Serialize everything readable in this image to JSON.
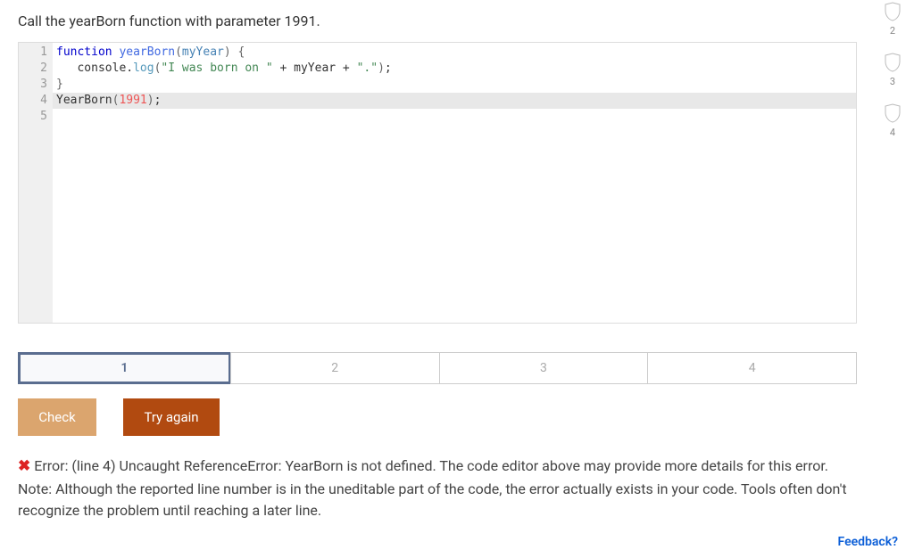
{
  "instruction": "Call the yearBorn function with parameter 1991.",
  "code": {
    "lines": [
      "1",
      "2",
      "3",
      "4",
      "5"
    ],
    "highlightLine": 4,
    "tokens": [
      {
        "line": 1,
        "segs": [
          {
            "t": "function",
            "c": "kw"
          },
          {
            "t": " "
          },
          {
            "t": "yearBorn",
            "c": "fn"
          },
          {
            "t": "(",
            "c": "paren"
          },
          {
            "t": "myYear",
            "c": "param"
          },
          {
            "t": ")",
            "c": "paren"
          },
          {
            "t": " "
          },
          {
            "t": "{",
            "c": "brace"
          }
        ]
      },
      {
        "line": 2,
        "segs": [
          {
            "t": "   "
          },
          {
            "t": "console",
            "c": "obj"
          },
          {
            "t": ".",
            "c": "dot"
          },
          {
            "t": "log",
            "c": "method"
          },
          {
            "t": "(",
            "c": "paren"
          },
          {
            "t": "\"I was born on \"",
            "c": "str"
          },
          {
            "t": " + ",
            "c": "op"
          },
          {
            "t": "myYear",
            "c": "var"
          },
          {
            "t": " + ",
            "c": "op"
          },
          {
            "t": "\".\"",
            "c": "str"
          },
          {
            "t": ")",
            "c": "paren"
          },
          {
            "t": ";",
            "c": "op"
          }
        ]
      },
      {
        "line": 3,
        "segs": [
          {
            "t": "}",
            "c": "brace"
          }
        ]
      },
      {
        "line": 4,
        "segs": [
          {
            "t": "YearBorn",
            "c": "var"
          },
          {
            "t": "(",
            "c": "paren"
          },
          {
            "t": "1991",
            "c": "num"
          },
          {
            "t": ")",
            "c": "paren"
          },
          {
            "t": ";",
            "c": "op"
          }
        ]
      },
      {
        "line": 5,
        "segs": [
          {
            "t": ""
          }
        ]
      }
    ]
  },
  "tabs": [
    {
      "label": "1",
      "active": true
    },
    {
      "label": "2",
      "active": false
    },
    {
      "label": "3",
      "active": false
    },
    {
      "label": "4",
      "active": false
    }
  ],
  "buttons": {
    "check": "Check",
    "tryagain": "Try again"
  },
  "error": {
    "icon": "✖",
    "text": "Error: (line 4) Uncaught ReferenceError: YearBorn is not defined. The code editor above may provide more details for this error. Note: Although the reported line number is in the uneditable part of the code, the error actually exists in your code. Tools often don't recognize the problem until reaching a later line."
  },
  "feedback": "Feedback?",
  "sideBadges": [
    "2",
    "3",
    "4"
  ]
}
